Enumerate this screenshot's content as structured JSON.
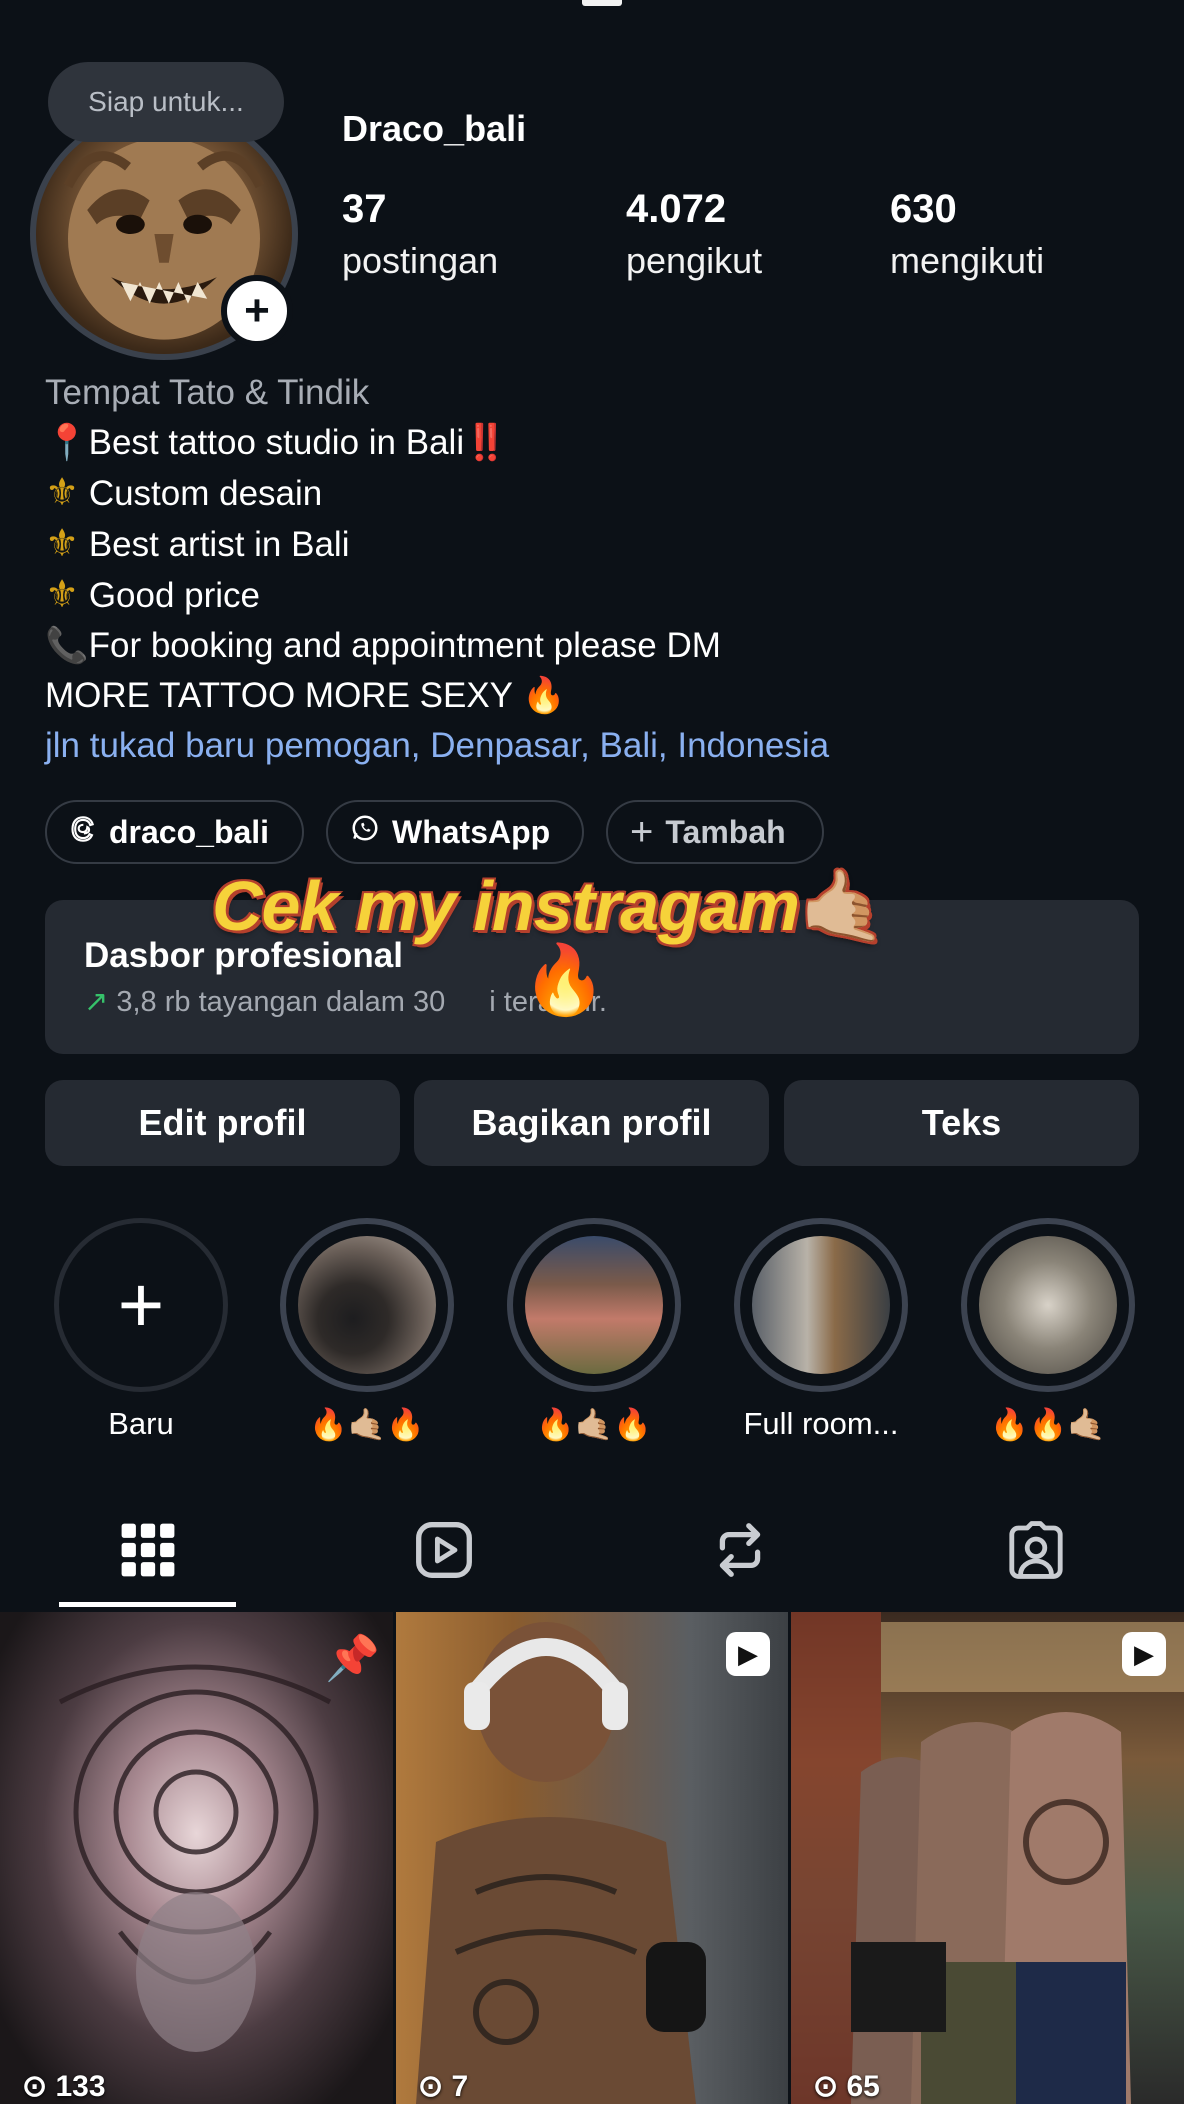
{
  "note": {
    "text": "Siap untuk..."
  },
  "profile": {
    "username": "Draco_bali",
    "stats": [
      {
        "value": "37",
        "label": "postingan"
      },
      {
        "value": "4.072",
        "label": "pengikut"
      },
      {
        "value": "630",
        "label": "mengikuti"
      }
    ]
  },
  "bio": {
    "category": "Tempat Tato & Tindik",
    "lines": [
      "Best tattoo studio in Bali",
      "Custom desain",
      "Best artist in Bali",
      "Good price",
      "For booking and appointment please DM",
      "MORE TATTOO MORE SEXY"
    ],
    "location": "jln tukad baru pemogan, Denpasar, Bali, Indonesia"
  },
  "links": {
    "threads": "draco_bali",
    "whatsapp": "WhatsApp",
    "add": "Tambah"
  },
  "dashboard": {
    "title": "Dasbor profesional",
    "subtitle_before": "3,8 rb tayangan dalam 30",
    "subtitle_after": "i terakhir."
  },
  "overlay": {
    "text": "Cek my instragam"
  },
  "actions": {
    "edit": "Edit profil",
    "share": "Bagikan profil",
    "text": "Teks"
  },
  "highlights": [
    {
      "label": "Baru"
    },
    {
      "label": "🔥🤙🏼🔥"
    },
    {
      "label": "🔥🤙🏼🔥"
    },
    {
      "label": "Full room..."
    },
    {
      "label": "🔥🔥🤙🏼"
    }
  ],
  "tabs": [
    "grid-icon",
    "reels-icon",
    "reposts-icon",
    "tagged-icon"
  ],
  "grid": [
    {
      "views": "133"
    },
    {
      "views": "7"
    },
    {
      "views": "65"
    }
  ],
  "colors": {
    "background": "#0c1117",
    "card": "#252a32",
    "link": "#8ab0f0",
    "overlay": "#f6d23a"
  }
}
